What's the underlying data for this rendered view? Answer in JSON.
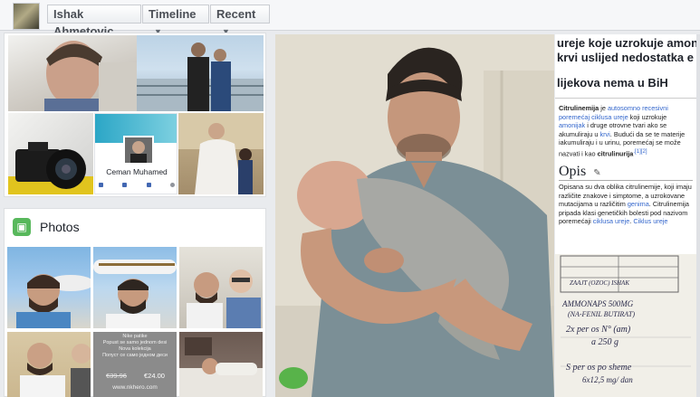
{
  "nav": {
    "profile_name": "Ishak Ahmetovic",
    "timeline_label": "Timeline",
    "recent_label": "Recent"
  },
  "friends_card": {
    "profile_caption": "Ceman Muhamed"
  },
  "photos": {
    "title": "Photos",
    "promo": {
      "line1": "Nike patike",
      "line2": "Popust se samo jednom desi",
      "line3": "Nova kolekcija",
      "line4": "Попуст се само једном деси",
      "price_old": "€39.96",
      "price_new": "€24.00",
      "url": "www.nkhero.com"
    }
  },
  "document": {
    "heading_lines": [
      "ureje koje uzrokuje amonija",
      "krvi uslijed nedostatka e",
      "",
      "lijekova nema u BiH"
    ],
    "para1": {
      "t1": "Citrulinemija",
      "t2": " je ",
      "l1": "autosomno recesivni poremećaj ciklusa ureje",
      "t3": " koji uzrokuje ",
      "l2": "amonijak",
      "t4": " i druge otrovne tvari ako se akumuliraju u ",
      "l3": "krvi",
      "t5": ". Budući da se te materije iakumuliraju i u urinu, poremećaj se može nazvati i kao ",
      "t6": "citrulinurija",
      "ref": ".[1][2]"
    },
    "section_title": "Opis",
    "para2": {
      "t1": "Opisana su dva oblika citrulinemije, koji imaju različite znakove i simptome, a uzrokovane mutacijama u različitim ",
      "l1": "genima",
      "t2": ". Citrulinemija pripada klasi genetičkih bolesti pod nazivom poremećaji ",
      "l2": "ciklusa ureje",
      "t3": ". ",
      "l3": "Ciklus ureje"
    }
  },
  "prescription": {
    "line1": "ZAAJT (OZOC) ISHAK",
    "line2": "AMMONAPS 500MG",
    "line3": "(NA-FENIL BUTIRAT)",
    "line4": "2x per os N° (am)",
    "line5": "a 250 g",
    "line6": "S per os po sheme",
    "line7": "6x12,5 mg/ dan"
  }
}
